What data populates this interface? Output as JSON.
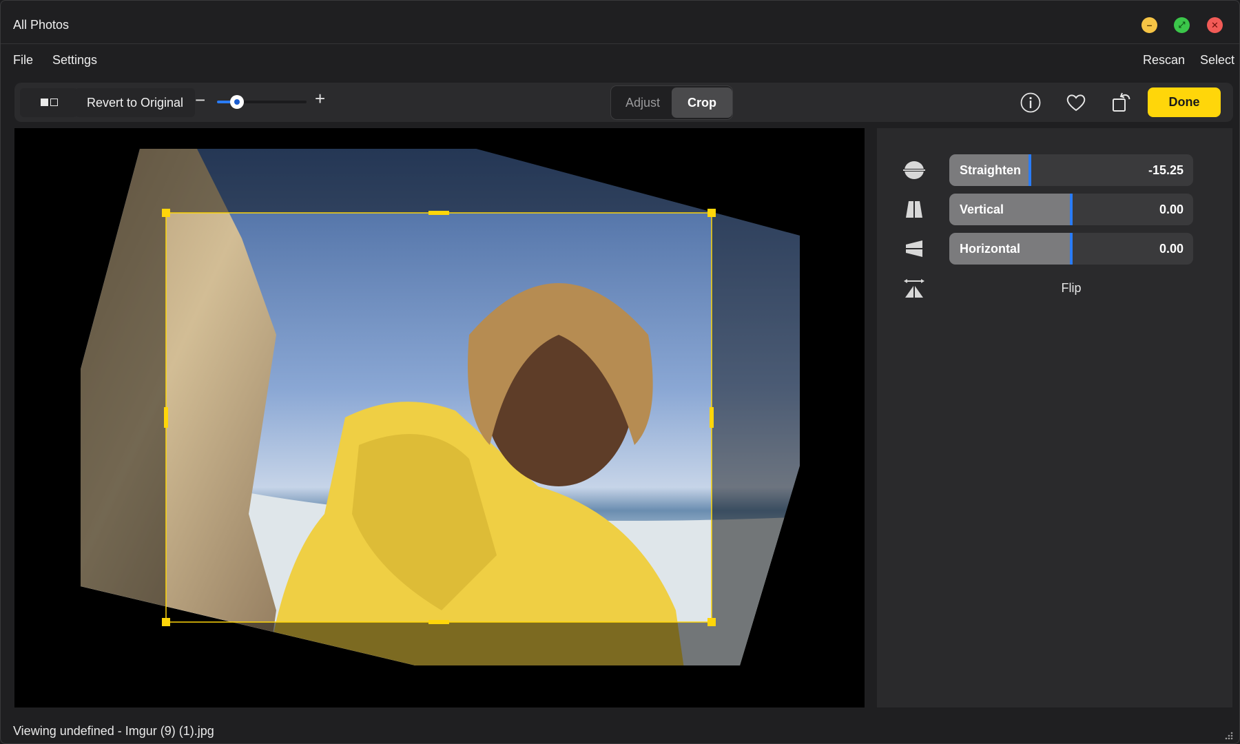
{
  "window": {
    "title": "All Photos"
  },
  "window_controls": {
    "minimize": "minimize-icon",
    "maximize": "maximize-icon",
    "close": "close-icon"
  },
  "menu": {
    "left": [
      "File",
      "Settings"
    ],
    "right": [
      "Rescan",
      "Select"
    ]
  },
  "toolbar": {
    "compare_icon": "compare-icon",
    "revert_label": "Revert to Original",
    "zoom_minus": "−",
    "zoom_plus": "+",
    "zoom_level_fraction": 0.22,
    "segments": [
      "Adjust",
      "Crop"
    ],
    "active_segment": "Crop",
    "info_icon": "info-icon",
    "favorite_icon": "heart-icon",
    "rotate_icon": "rotate-icon",
    "done_label": "Done",
    "accent_color": "#ffd60a"
  },
  "adjustments": [
    {
      "icon": "straighten-icon",
      "label": "Straighten",
      "value": "-15.25",
      "level_fraction": 0.33
    },
    {
      "icon": "vertical-perspective-icon",
      "label": "Vertical",
      "value": "0.00",
      "level_fraction": 0.5
    },
    {
      "icon": "horizontal-perspective-icon",
      "label": "Horizontal",
      "value": "0.00",
      "level_fraction": 0.5
    }
  ],
  "flip": {
    "icon": "flip-icon",
    "label": "Flip"
  },
  "status": {
    "text": "Viewing undefined - Imgur (9) (1).jpg"
  },
  "colors": {
    "slider_marker": "#2a7cf6",
    "crop_frame": "#ffd60a"
  }
}
